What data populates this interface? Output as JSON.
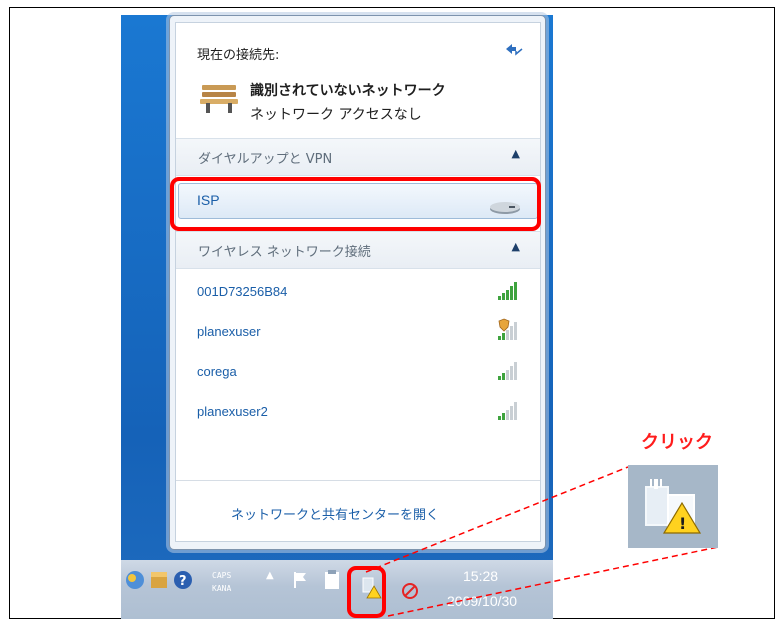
{
  "popup": {
    "connected_header": "現在の接続先:",
    "network_name": "識別されていないネットワーク",
    "network_status": "ネットワーク アクセスなし",
    "dialup_section": "ダイヤルアップと VPN",
    "dialup_item": "ISP",
    "wireless_section": "ワイヤレス ネットワーク接続",
    "wireless_networks": [
      {
        "name": "001D73256B84",
        "signal_bars": 5,
        "secured": false
      },
      {
        "name": "planexuser",
        "signal_bars": 2,
        "secured": true
      },
      {
        "name": "corega",
        "signal_bars": 2,
        "secured": false
      },
      {
        "name": "planexuser2",
        "signal_bars": 2,
        "secured": false
      }
    ],
    "footer_link": "ネットワークと共有センターを開く"
  },
  "taskbar": {
    "caps_label": "CAPS",
    "kana_label": "KANA",
    "time": "15:28",
    "date": "2009/10/30"
  },
  "annotation": {
    "click_label": "クリック"
  },
  "colors": {
    "highlight_red": "#ff0000",
    "link_blue": "#1a5ea8",
    "desktop_blue": "#1a78d2"
  }
}
